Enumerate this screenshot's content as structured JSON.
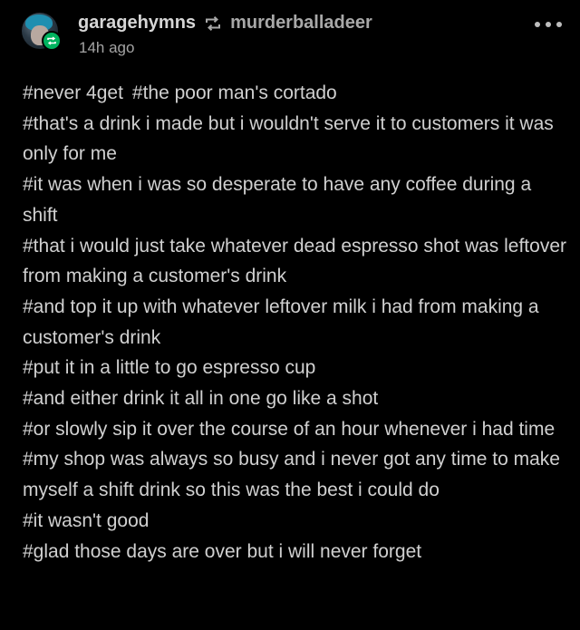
{
  "post": {
    "author": "garagehymns",
    "reblogged_from": "murderballadeer",
    "timestamp": "14h ago",
    "menu_icon": "more-horizontal-icon",
    "reblog_icon": "reblog-icon",
    "accent_green": "#00b35f",
    "background": "#000000",
    "tags": [
      "#never 4get",
      "#the poor man's cortado",
      "#that's a drink i made but i wouldn't serve it to customers it was only for me",
      "#it was when i was so desperate to have any coffee during a shift",
      "#that i would just take whatever dead espresso shot was leftover from making a customer's drink",
      "#and top it up with whatever leftover milk i had from making a customer's drink",
      "#put it in a little to go espresso cup",
      "#and either drink it all in one go like a shot",
      "#or slowly sip it over the course of an hour whenever i had time",
      "#my shop was always so busy and i never got any time to make myself a shift drink so this was the best i could do",
      "#it wasn't good",
      "#glad those days are over but i will never forget"
    ]
  }
}
